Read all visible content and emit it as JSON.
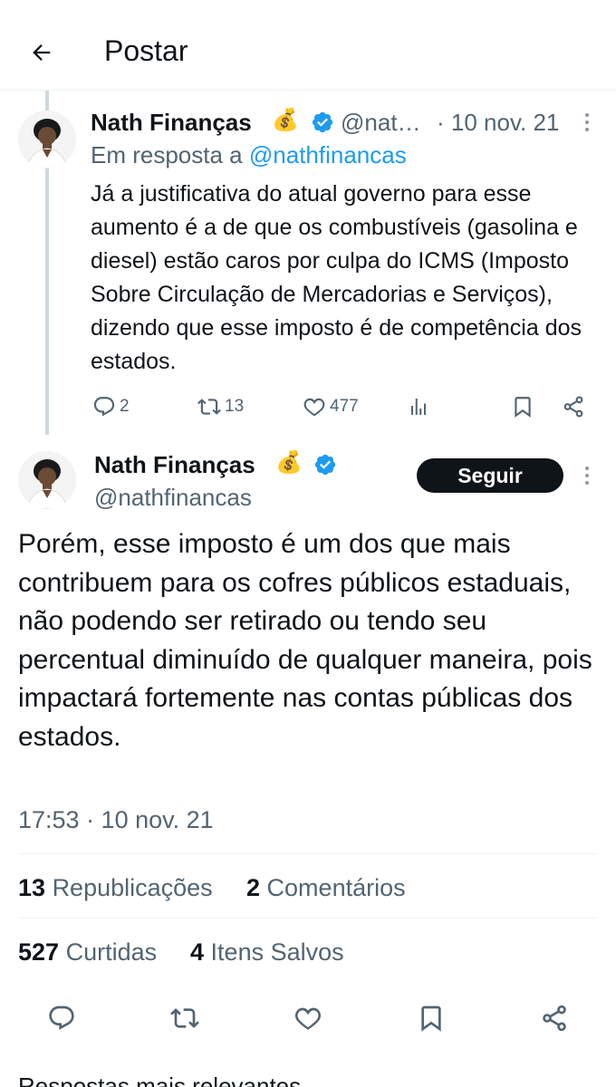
{
  "header": {
    "title": "Postar",
    "back_icon": "arrow-left-icon"
  },
  "parent_post": {
    "author_name": "Nath Finanças",
    "author_emoji": "💰",
    "handle": "@nat…",
    "date": "· 10 nov. 21",
    "reply_prefix": "Em resposta a",
    "reply_mention": "@nathfinancas",
    "text": "Já a justificativa do atual governo para esse aumento é a de que os combustíveis (gasolina e diesel) estão caros por culpa do ICMS (Imposto Sobre Circulação de Mercadorias e Serviços), dizendo que esse imposto é de competência dos estados.",
    "replies": "2",
    "reposts": "13",
    "likes": "477"
  },
  "main_post": {
    "author_name": "Nath Finanças",
    "author_emoji": "💰",
    "handle": "@nathfinancas",
    "follow_label": "Seguir",
    "text": "Porém, esse imposto é um dos que mais contribuem para os cofres públicos estaduais, não podendo ser retirado ou tendo seu percentual diminuído de qualquer maneira, pois impactará fortemente nas contas públicas dos estados.",
    "timestamp": "17:53 · 10 nov. 21"
  },
  "stats": {
    "reposts_count": "13",
    "reposts_label": "Republicações",
    "comments_count": "2",
    "comments_label": "Comentários",
    "likes_count": "527",
    "likes_label": "Curtidas",
    "saves_count": "4",
    "saves_label": "Itens Salvos"
  },
  "replies_sort": "Respostas mais relevantes ⌄",
  "colors": {
    "accent": "#1d9bf0",
    "text": "#0f1419",
    "secondary": "#536471",
    "verified": "#1d9bf0"
  }
}
